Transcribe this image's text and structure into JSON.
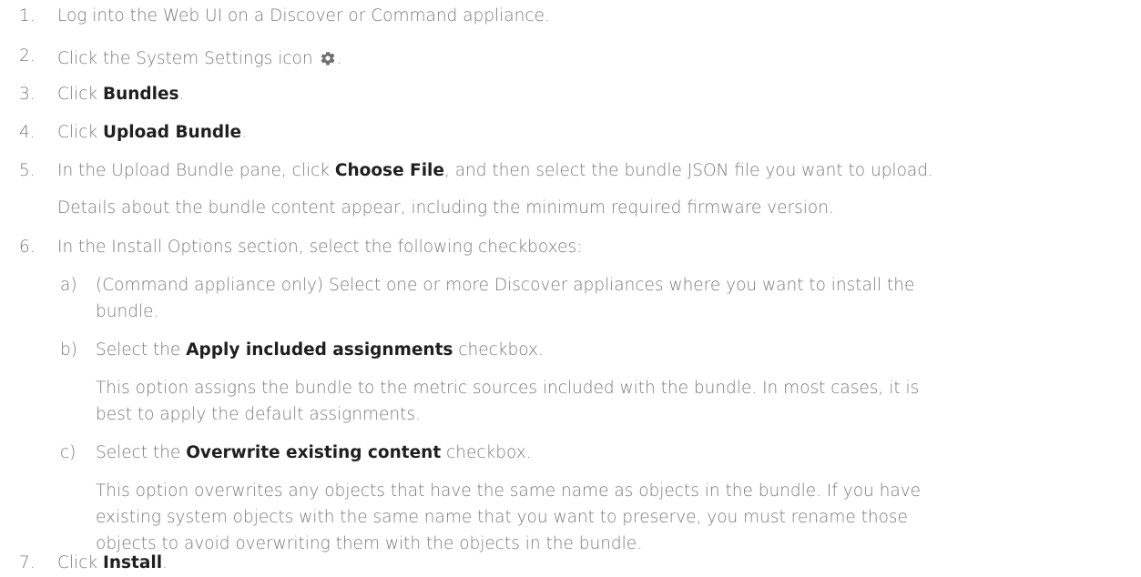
{
  "steps": [
    {
      "num": "1.",
      "text": "Log into the Web UI on a Discover or Command appliance."
    },
    {
      "num": "2.",
      "text_before_icon": "Click the System Settings icon ",
      "icon": "gear-icon",
      "text_after_icon": "."
    },
    {
      "num": "3.",
      "text_before": "Click ",
      "bold": "Bundles",
      "text_after": "."
    },
    {
      "num": "4.",
      "text_before": "Click ",
      "bold": "Upload Bundle",
      "text_after": "."
    },
    {
      "num": "5.",
      "text_before": "In the Upload Bundle pane, click ",
      "bold": "Choose File",
      "text_after": ", and then select the bundle JSON file you want to upload.",
      "detail": "Details about the bundle content appear, including the minimum required firmware version."
    },
    {
      "num": "6.",
      "text": "In the Install Options section, select the following checkboxes:"
    },
    {
      "num": "7.",
      "text_before": "Click ",
      "bold": "Install",
      "text_after": "."
    }
  ],
  "substeps": [
    {
      "letter": "a)",
      "line1": "(Command appliance only) Select one or more Discover appliances where you want to install the",
      "line2": "bundle."
    },
    {
      "letter": "b)",
      "text_before": "Select the ",
      "bold": "Apply included assignments",
      "text_after": " checkbox.",
      "detail_line1": "This option assigns the bundle to the metric sources included with the bundle. In most cases, it is",
      "detail_line2": "best to apply the default assignments."
    },
    {
      "letter": "c)",
      "text_before": "Select the ",
      "bold": "Overwrite existing content",
      "text_after": " checkbox.",
      "detail_line1": "This option overwrites any objects that have the same name as objects in the bundle. If you have",
      "detail_line2": "existing system objects with the same name that you want to preserve, you must rename those",
      "detail_line3": "objects to avoid overwriting them with the objects in the bundle."
    }
  ]
}
